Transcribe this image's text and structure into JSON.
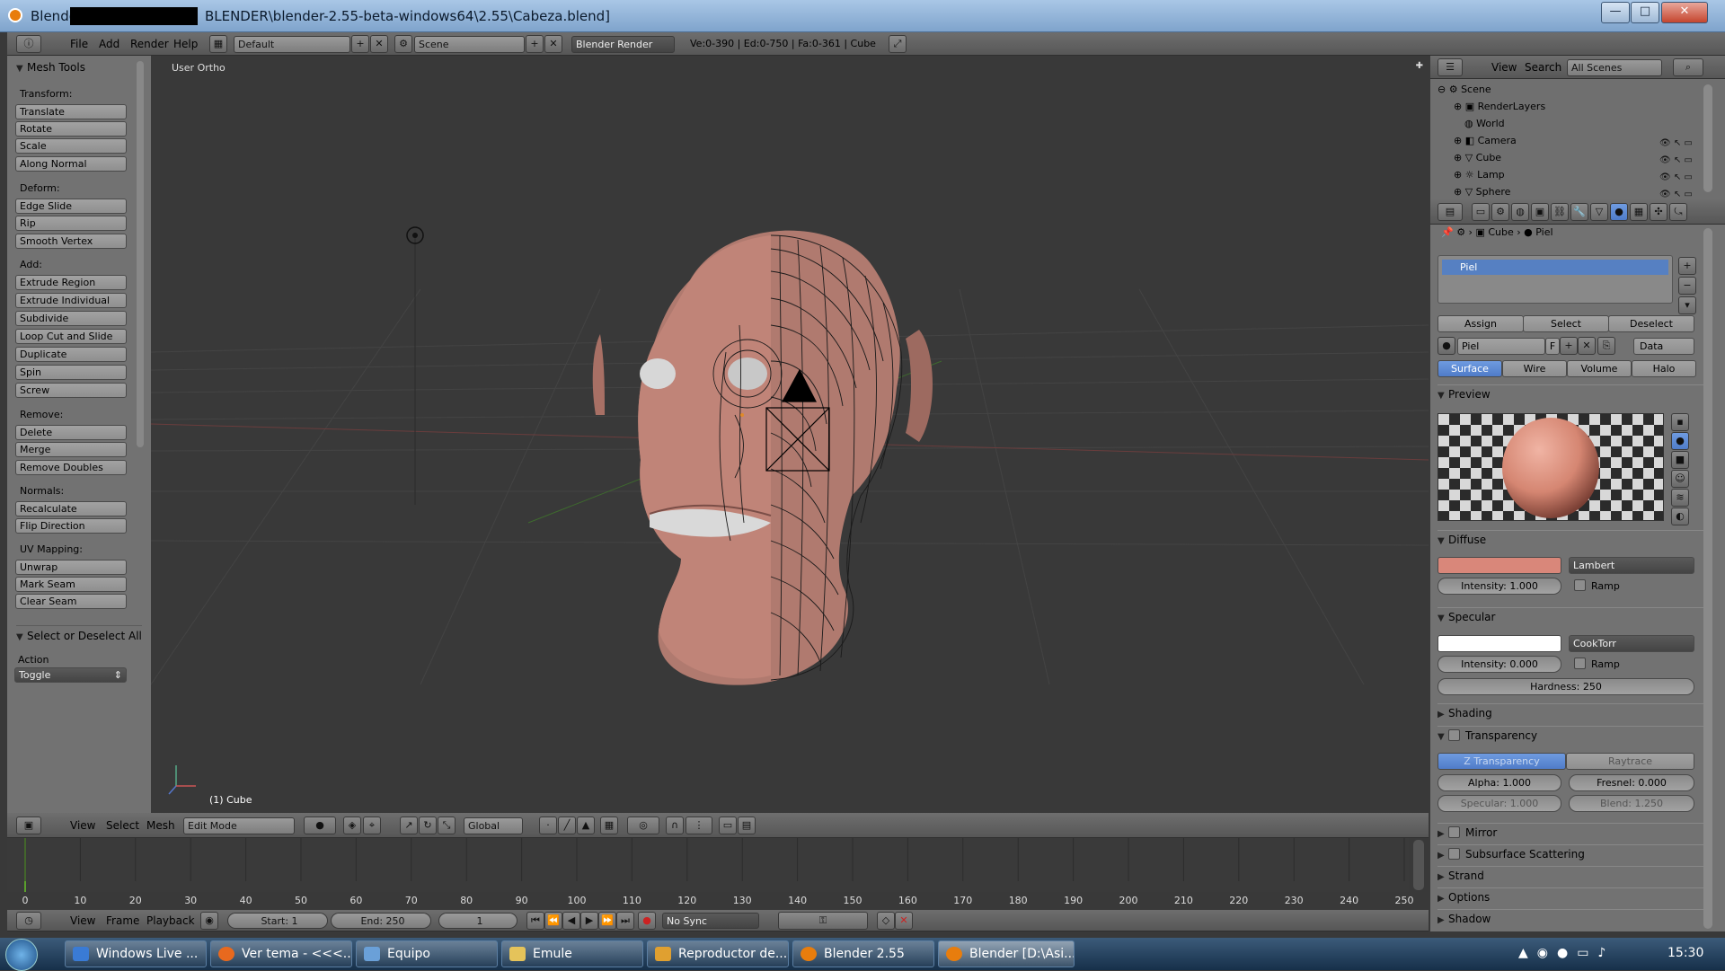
{
  "window": {
    "title_prefix": "Blende",
    "title_suffix": "BLENDER\\blender-2.55-beta-windows64\\2.55\\Cabeza.blend]",
    "btn_minimize": "—",
    "btn_maximize": "□",
    "btn_close": "✕"
  },
  "info_header": {
    "menu": [
      "File",
      "Add",
      "Render",
      "Help"
    ],
    "screen_layout": "Default",
    "scene": "Scene",
    "render_engine": "Blender Render",
    "stats": "Ve:0-390 | Ed:0-750 | Fa:0-361 | Cube"
  },
  "toolshelf": {
    "title": "Mesh Tools",
    "groups": [
      {
        "label": "Transform:",
        "buttons": [
          "Translate",
          "Rotate",
          "Scale",
          "Along Normal"
        ]
      },
      {
        "label": "Deform:",
        "buttons": [
          "Edge Slide",
          "Rip",
          "Smooth Vertex"
        ]
      },
      {
        "label": "Add:",
        "buttons": [
          "Extrude Region",
          "Extrude Individual",
          "Subdivide",
          "Loop Cut and Slide",
          "Duplicate",
          "Spin",
          "Screw"
        ]
      },
      {
        "label": "Remove:",
        "buttons": [
          "Delete",
          "Merge",
          "Remove Doubles"
        ]
      },
      {
        "label": "Normals:",
        "buttons": [
          "Recalculate",
          "Flip Direction"
        ]
      },
      {
        "label": "UV Mapping:",
        "buttons": [
          "Unwrap",
          "Mark Seam",
          "Clear Seam"
        ]
      }
    ],
    "select_panel_title": "Select or Deselect All",
    "action_label": "Action",
    "action_value": "Toggle"
  },
  "viewport": {
    "view_label": "User Ortho",
    "object_label": "(1) Cube"
  },
  "view3d_header": {
    "menu": [
      "View",
      "Select",
      "Mesh"
    ],
    "mode": "Edit Mode",
    "orientation": "Global"
  },
  "outliner": {
    "menu": [
      "View",
      "Search"
    ],
    "filter": "All Scenes",
    "items": [
      "Scene",
      "RenderLayers",
      "World",
      "Camera",
      "Cube",
      "Lamp",
      "Sphere"
    ]
  },
  "properties": {
    "breadcrumb": [
      "Cube",
      "Piel"
    ],
    "material_slot": "Piel",
    "slot_buttons": [
      "Assign",
      "Select",
      "Deselect"
    ],
    "material_name": "Piel",
    "fake_user": "F",
    "link_mode": "Data",
    "tabs": [
      "Surface",
      "Wire",
      "Volume",
      "Halo"
    ],
    "active_tab": "Surface",
    "panels": {
      "preview": "Preview",
      "diffuse": "Diffuse",
      "specular": "Specular",
      "shading": "Shading",
      "transparency": "Transparency",
      "mirror": "Mirror",
      "sss": "Subsurface Scattering",
      "strand": "Strand",
      "options": "Options",
      "shadow": "Shadow"
    },
    "diffuse_color": "#d9877a",
    "diffuse_shader": "Lambert",
    "diffuse_intensity": "Intensity: 1.000",
    "ramp": "Ramp",
    "specular_color": "#ffffff",
    "specular_shader": "CookTorr",
    "specular_intensity": "Intensity: 0.000",
    "hardness": "Hardness: 250",
    "transp_modes": [
      "Z Transparency",
      "Raytrace"
    ],
    "alpha": "Alpha: 1.000",
    "fresnel": "Fresnel: 0.000",
    "trans_specular": "Specular: 1.000",
    "blend": "Blend: 1.250"
  },
  "timeline": {
    "ticks": [
      "0",
      "10",
      "20",
      "30",
      "40",
      "50",
      "60",
      "70",
      "80",
      "90",
      "100",
      "110",
      "120",
      "130",
      "140",
      "150",
      "160",
      "170",
      "180",
      "190",
      "200",
      "210",
      "220",
      "230",
      "240",
      "250"
    ],
    "menu": [
      "View",
      "Frame",
      "Playback"
    ],
    "start": "Start: 1",
    "end": "End: 250",
    "current": "1",
    "sync": "No Sync"
  },
  "taskbar": {
    "tasks": [
      "Windows Live ...",
      "Ver tema - <<<...",
      "Equipo",
      "Emule",
      "Reproductor de...",
      "Blender 2.55",
      "Blender [D:\\Asi..."
    ],
    "clock": "15:30"
  }
}
